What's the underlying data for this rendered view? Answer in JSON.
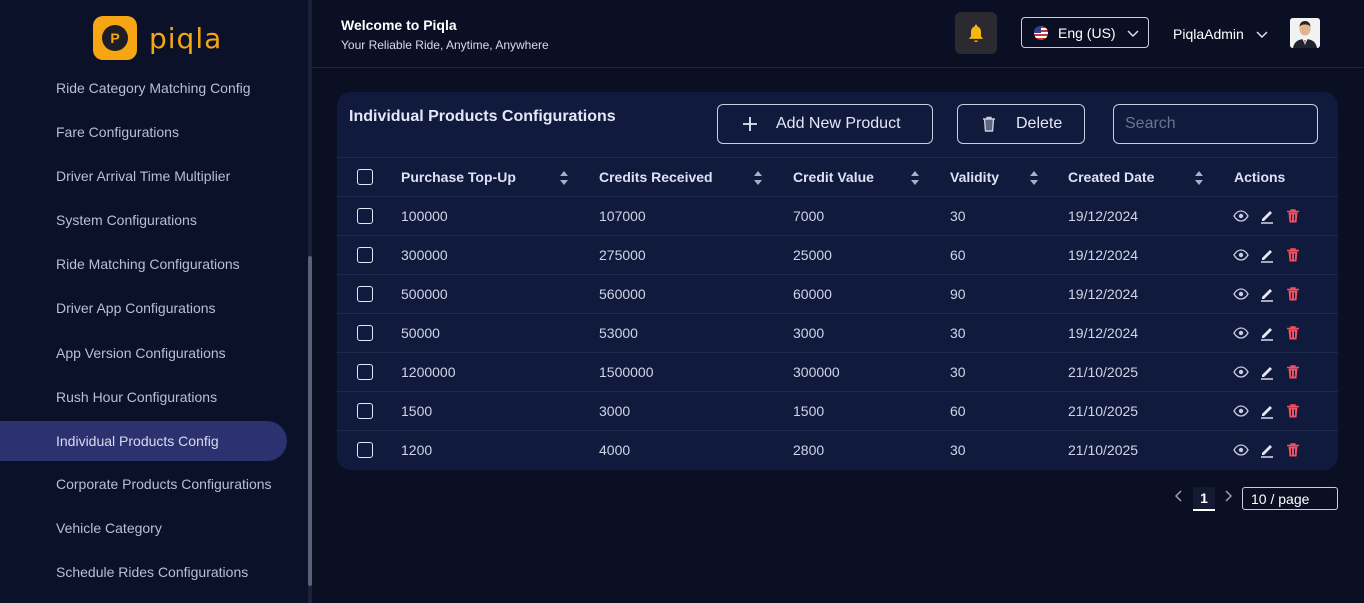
{
  "brand": {
    "name": "piqla",
    "badge_letter": "P",
    "accent": "#f5a612"
  },
  "sidebar": {
    "items": [
      {
        "label": "Ride Category Matching Config",
        "active": false
      },
      {
        "label": "Fare Configurations",
        "active": false
      },
      {
        "label": "Driver Arrival Time Multiplier",
        "active": false
      },
      {
        "label": "System Configurations",
        "active": false
      },
      {
        "label": "Ride Matching Configurations",
        "active": false
      },
      {
        "label": "Driver App Configurations",
        "active": false
      },
      {
        "label": "App Version Configurations",
        "active": false
      },
      {
        "label": "Rush Hour Configurations",
        "active": false
      },
      {
        "label": "Individual Products Config",
        "active": true
      },
      {
        "label": "Corporate Products Configurations",
        "active": false
      },
      {
        "label": "Vehicle Category",
        "active": false
      },
      {
        "label": "Schedule Rides Configurations",
        "active": false
      }
    ]
  },
  "header": {
    "title": "Welcome to Piqla",
    "subtitle": "Your Reliable Ride, Anytime, Anywhere",
    "language": "Eng (US)",
    "user": "PiqlaAdmin"
  },
  "card": {
    "title": "Individual Products Configurations",
    "add_label": "Add New Product",
    "delete_label": "Delete",
    "search_placeholder": "Search"
  },
  "table": {
    "columns": [
      "Purchase Top-Up",
      "Credits Received",
      "Credit Value",
      "Validity",
      "Created Date",
      "Actions"
    ],
    "rows": [
      [
        "100000",
        "107000",
        "7000",
        "30",
        "19/12/2024"
      ],
      [
        "300000",
        "275000",
        "25000",
        "60",
        "19/12/2024"
      ],
      [
        "500000",
        "560000",
        "60000",
        "90",
        "19/12/2024"
      ],
      [
        "50000",
        "53000",
        "3000",
        "30",
        "19/12/2024"
      ],
      [
        "1200000",
        "1500000",
        "300000",
        "30",
        "21/10/2025"
      ],
      [
        "1500",
        "3000",
        "1500",
        "60",
        "21/10/2025"
      ],
      [
        "1200",
        "4000",
        "2800",
        "30",
        "21/10/2025"
      ]
    ]
  },
  "pagination": {
    "current_page": "1",
    "page_size": "10 / page"
  }
}
